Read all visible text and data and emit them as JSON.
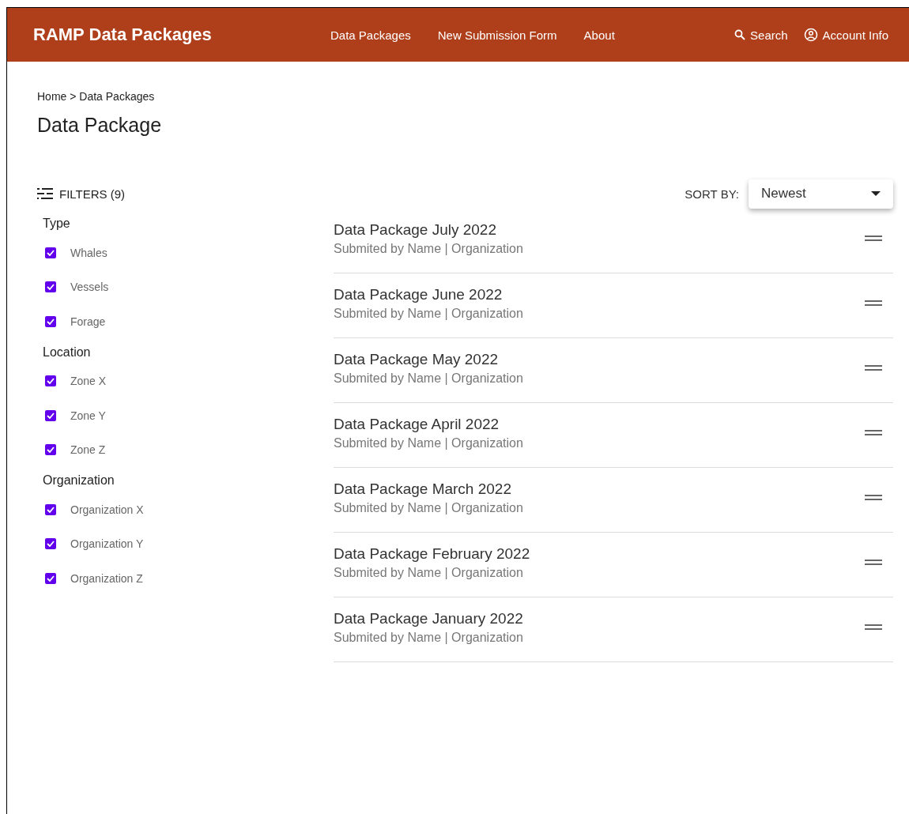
{
  "header": {
    "title": "RAMP Data Packages",
    "nav": [
      "Data Packages",
      "New Submission Form",
      "About"
    ],
    "search": "Search",
    "account": "Account Info"
  },
  "breadcrumb": "Home > Data Packages",
  "page_title": "Data Package",
  "filters": {
    "label": "FILTERS (9)",
    "groups": [
      {
        "title": "Type",
        "options": [
          {
            "label": "Whales",
            "checked": true
          },
          {
            "label": "Vessels",
            "checked": true
          },
          {
            "label": "Forage",
            "checked": true
          }
        ]
      },
      {
        "title": "Location",
        "options": [
          {
            "label": "Zone X",
            "checked": true
          },
          {
            "label": "Zone Y",
            "checked": true
          },
          {
            "label": "Zone Z",
            "checked": true
          }
        ]
      },
      {
        "title": "Organization",
        "options": [
          {
            "label": "Organization X",
            "checked": true
          },
          {
            "label": "Organization Y",
            "checked": true
          },
          {
            "label": "Organization Z",
            "checked": true
          }
        ]
      }
    ]
  },
  "sort": {
    "label": "SORT BY:",
    "value": "Newest"
  },
  "packages": [
    {
      "title": "Data Package July 2022",
      "subtitle": "Submited by Name | Organization"
    },
    {
      "title": "Data Package June 2022",
      "subtitle": "Submited by Name | Organization"
    },
    {
      "title": "Data Package May 2022",
      "subtitle": "Submited by Name | Organization"
    },
    {
      "title": "Data Package April 2022",
      "subtitle": "Submited by Name | Organization"
    },
    {
      "title": "Data Package March 2022",
      "subtitle": "Submited by Name | Organization"
    },
    {
      "title": "Data Package February 2022",
      "subtitle": "Submited by Name | Organization"
    },
    {
      "title": "Data Package January 2022",
      "subtitle": "Submited by Name | Organization"
    }
  ]
}
